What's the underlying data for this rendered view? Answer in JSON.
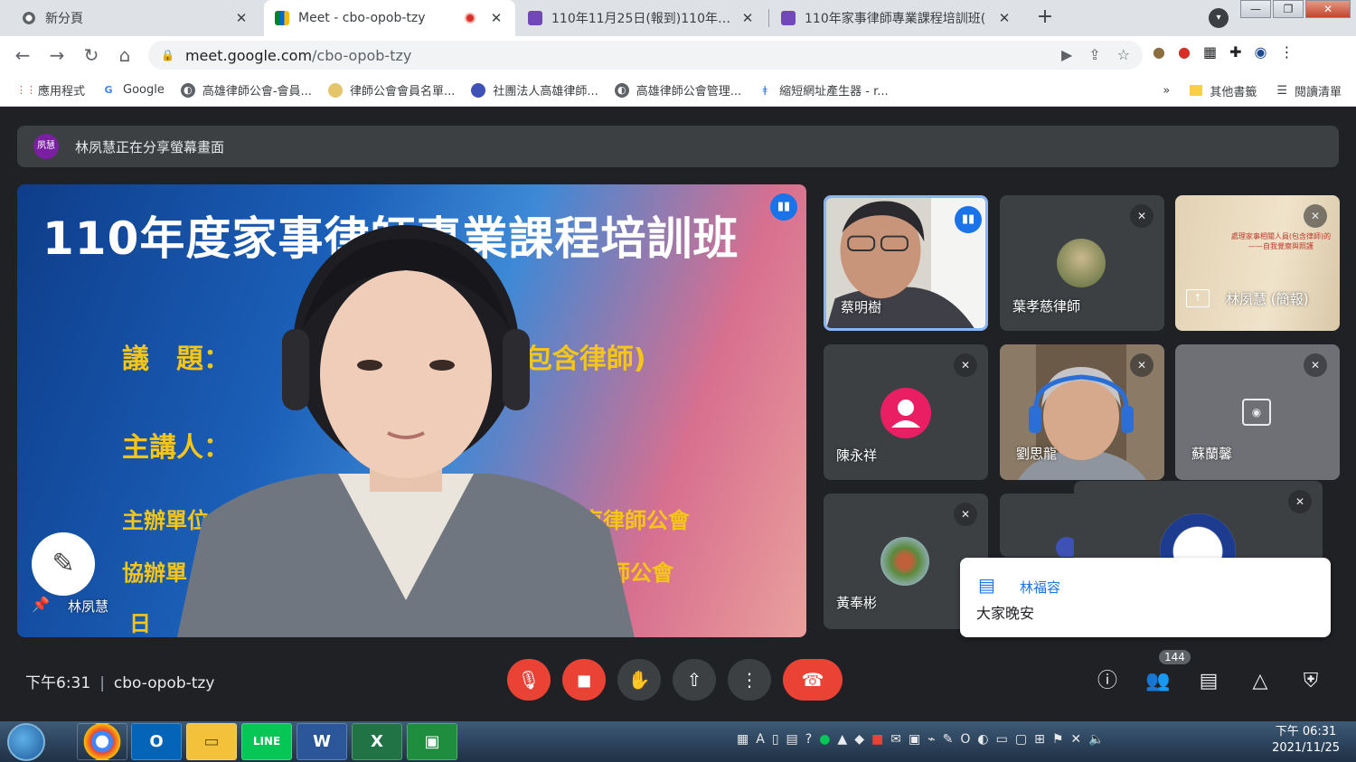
{
  "tabs": [
    {
      "title": "新分頁",
      "icon": "chrome-icon"
    },
    {
      "title": "Meet - cbo-opob-tzy",
      "icon": "meet-icon"
    },
    {
      "title": "110年11月25日(報到)110年度家",
      "icon": "forms-icon"
    },
    {
      "title": "110年家事律師專業課程培訓班(",
      "icon": "forms-icon"
    }
  ],
  "address": {
    "host": "meet.google.com",
    "path": "/cbo-opob-tzy"
  },
  "bookmarks": [
    {
      "label": "應用程式"
    },
    {
      "label": "Google"
    },
    {
      "label": "高雄律師公會-會員..."
    },
    {
      "label": "律師公會會員名單..."
    },
    {
      "label": "社團法人高雄律師..."
    },
    {
      "label": "高雄律師公會管理..."
    },
    {
      "label": "縮短網址產生器 - r..."
    }
  ],
  "bookmarks_right": {
    "overflow": "»",
    "other": "其他書籤",
    "reading": "閱讀清單"
  },
  "meet": {
    "presenting_avatar": "夙慧",
    "presenting_text": "林夙慧正在分享螢幕畫面",
    "main_tile": {
      "slide_title": "110年度家事律師專業課程培訓班",
      "slide_lines": [
        "議　題：",
        "(包含律師)",
        "主講人：",
        "主辦單位",
        "屏東律師公會",
        "協辦單",
        "律師公會",
        "日"
      ],
      "name": "林夙慧"
    },
    "participants": [
      {
        "name": "蔡明樹",
        "speaking": true
      },
      {
        "name": "葉孝慈律師",
        "speaking": false
      },
      {
        "name": "林夙慧 (簡報)",
        "speaking": false,
        "slide_text": "處理家事相關人員(包含律師)的——自我覺察與照護"
      },
      {
        "name": "陳永祥",
        "speaking": false
      },
      {
        "name": "劉思龍",
        "speaking": false
      },
      {
        "name": "蘇蘭馨",
        "speaking": false
      },
      {
        "name": "黃奉彬",
        "speaking": false
      }
    ],
    "chat_toast": {
      "sender": "林福容",
      "message": "大家晚安"
    },
    "time": "下午6:31",
    "meeting_code": "cbo-opob-tzy",
    "participant_count": "144"
  },
  "taskbar": {
    "apps": [
      "chrome-icon",
      "outlook-icon",
      "explorer-icon",
      "line-icon",
      "word-icon",
      "excel-icon",
      "classroom-icon"
    ],
    "time": "下午 06:31",
    "date": "2021/11/25"
  },
  "colors": {
    "accent": "#1a73e8",
    "danger": "#ea4335",
    "surface": "#3c4043",
    "background": "#202124"
  }
}
